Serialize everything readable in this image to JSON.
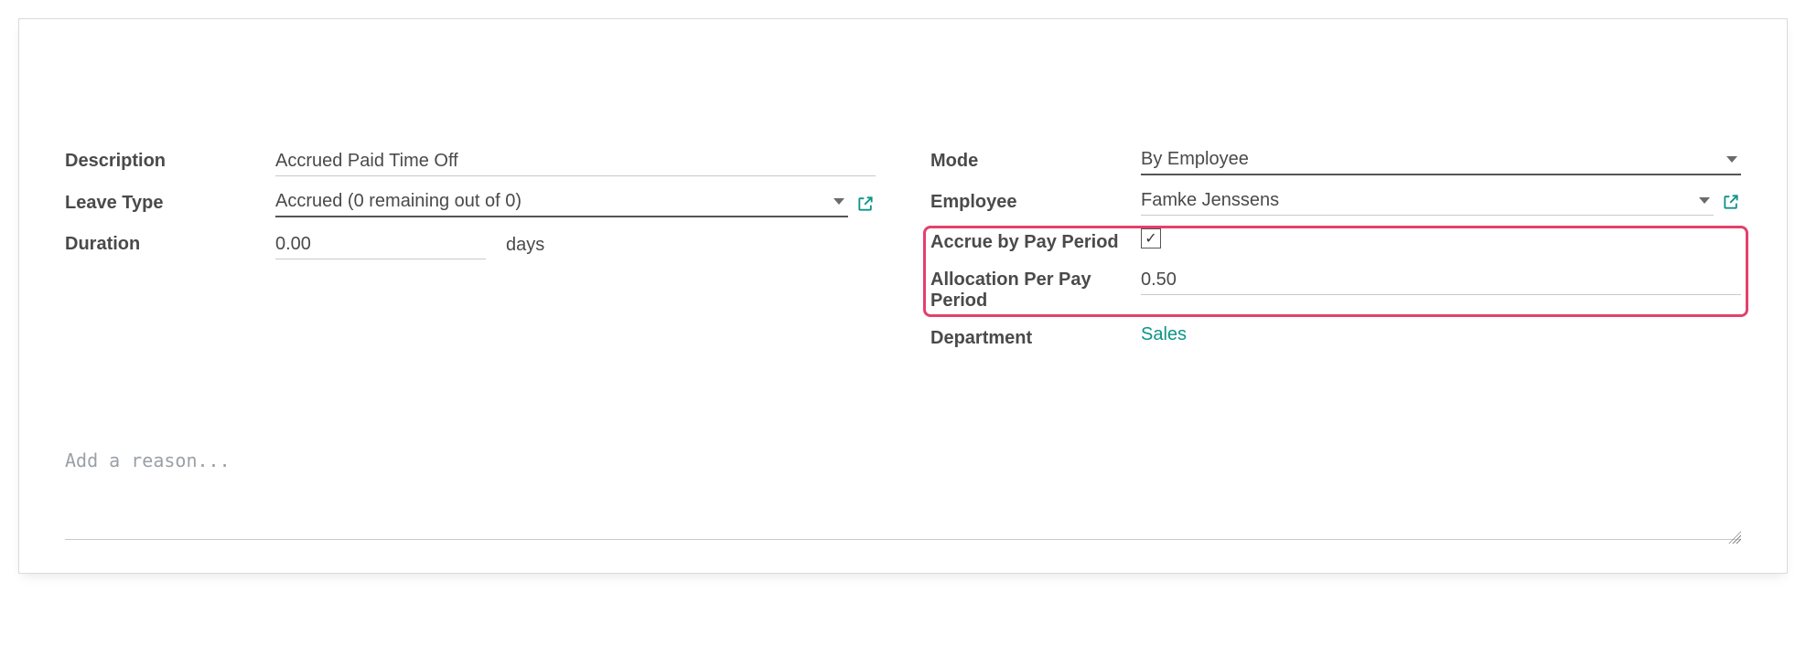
{
  "left": {
    "description_label": "Description",
    "description_value": "Accrued Paid Time Off",
    "leave_type_label": "Leave Type",
    "leave_type_value": "Accrued (0 remaining out of 0)",
    "duration_label": "Duration",
    "duration_value": "0.00",
    "duration_unit": "days"
  },
  "right": {
    "mode_label": "Mode",
    "mode_value": "By Employee",
    "employee_label": "Employee",
    "employee_value": "Famke Jenssens",
    "accrue_label": "Accrue by Pay Period",
    "accrue_checked": true,
    "allocation_label": "Allocation Per Pay Period",
    "allocation_value": "0.50",
    "department_label": "Department",
    "department_value": "Sales"
  },
  "reason_placeholder": "Add a reason...",
  "checkmark_glyph": "✓"
}
